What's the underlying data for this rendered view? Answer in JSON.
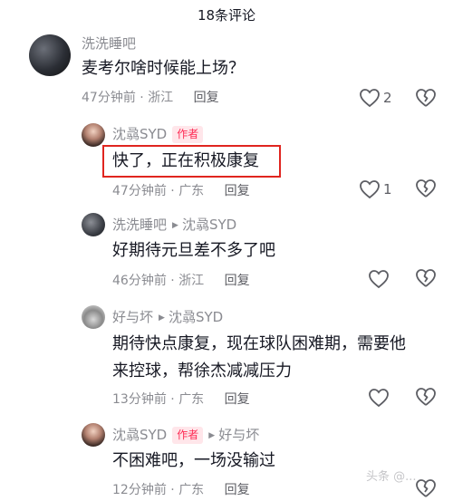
{
  "header": {
    "title": "18条评论"
  },
  "comments": [
    {
      "username": "洗洗睡吧",
      "text": "麦考尔啥时候能上场？",
      "time": "47分钟前",
      "location": "浙江",
      "reply_label": "回复",
      "likes": "2"
    },
    {
      "username": "沈骉SYD",
      "badge": "作者",
      "text": "快了，正在积极康复",
      "time": "47分钟前",
      "location": "广东",
      "reply_label": "回复",
      "likes": "1"
    },
    {
      "username": "洗洗睡吧",
      "reply_to": "沈骉SYD",
      "text": "好期待元旦差不多了吧",
      "time": "46分钟前",
      "location": "浙江",
      "reply_label": "回复"
    },
    {
      "username": "好与坏",
      "reply_to": "沈骉SYD",
      "text_line1": "期待快点康复，现在球队困难期，需要他",
      "text_line2": "来控球，帮徐杰减减压力",
      "time": "13分钟前",
      "location": "广东",
      "reply_label": "回复"
    },
    {
      "username": "沈骉SYD",
      "badge": "作者",
      "reply_to": "好与坏",
      "text": "不困难吧，一场没输过",
      "time": "12分钟前",
      "location": "广东",
      "reply_label": "回复"
    }
  ],
  "watermark": "头条 @...",
  "icons": {
    "like": "heart-outline-icon",
    "dislike": "broken-heart-icon",
    "reply_arrow": "triangle-right-icon"
  },
  "colors": {
    "author_badge": "#fe2c55",
    "highlight_box": "#e0251f",
    "meta_text": "#8a8b91"
  }
}
